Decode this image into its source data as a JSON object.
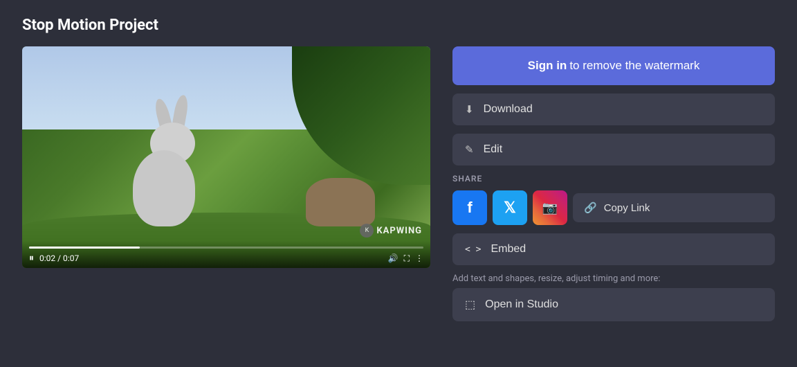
{
  "page": {
    "title": "Stop Motion Project",
    "background_color": "#2d2f3a"
  },
  "video": {
    "time_current": "0:02",
    "time_total": "0:07",
    "time_display": "0:02 / 0:07",
    "progress_percent": 28,
    "watermark": "KAPWING",
    "state": "playing"
  },
  "actions": {
    "sign_in_bold": "Sign in",
    "sign_in_rest": " to remove the watermark",
    "download_label": "Download",
    "edit_label": "Edit",
    "copy_link_label": "Copy Link",
    "embed_label": "Embed",
    "open_in_studio_label": "Open in Studio",
    "studio_hint": "Add text and shapes, resize, adjust timing and more:"
  },
  "share": {
    "label": "SHARE",
    "facebook_label": "f",
    "twitter_label": "𝕏",
    "instagram_label": "📷"
  },
  "icons": {
    "download": "⬇",
    "edit": "✎",
    "link": "🔗",
    "embed": "<>",
    "open_external": "⬚",
    "pause": "⏸",
    "volume": "🔊",
    "fullscreen": "⛶",
    "more": "⋮"
  }
}
